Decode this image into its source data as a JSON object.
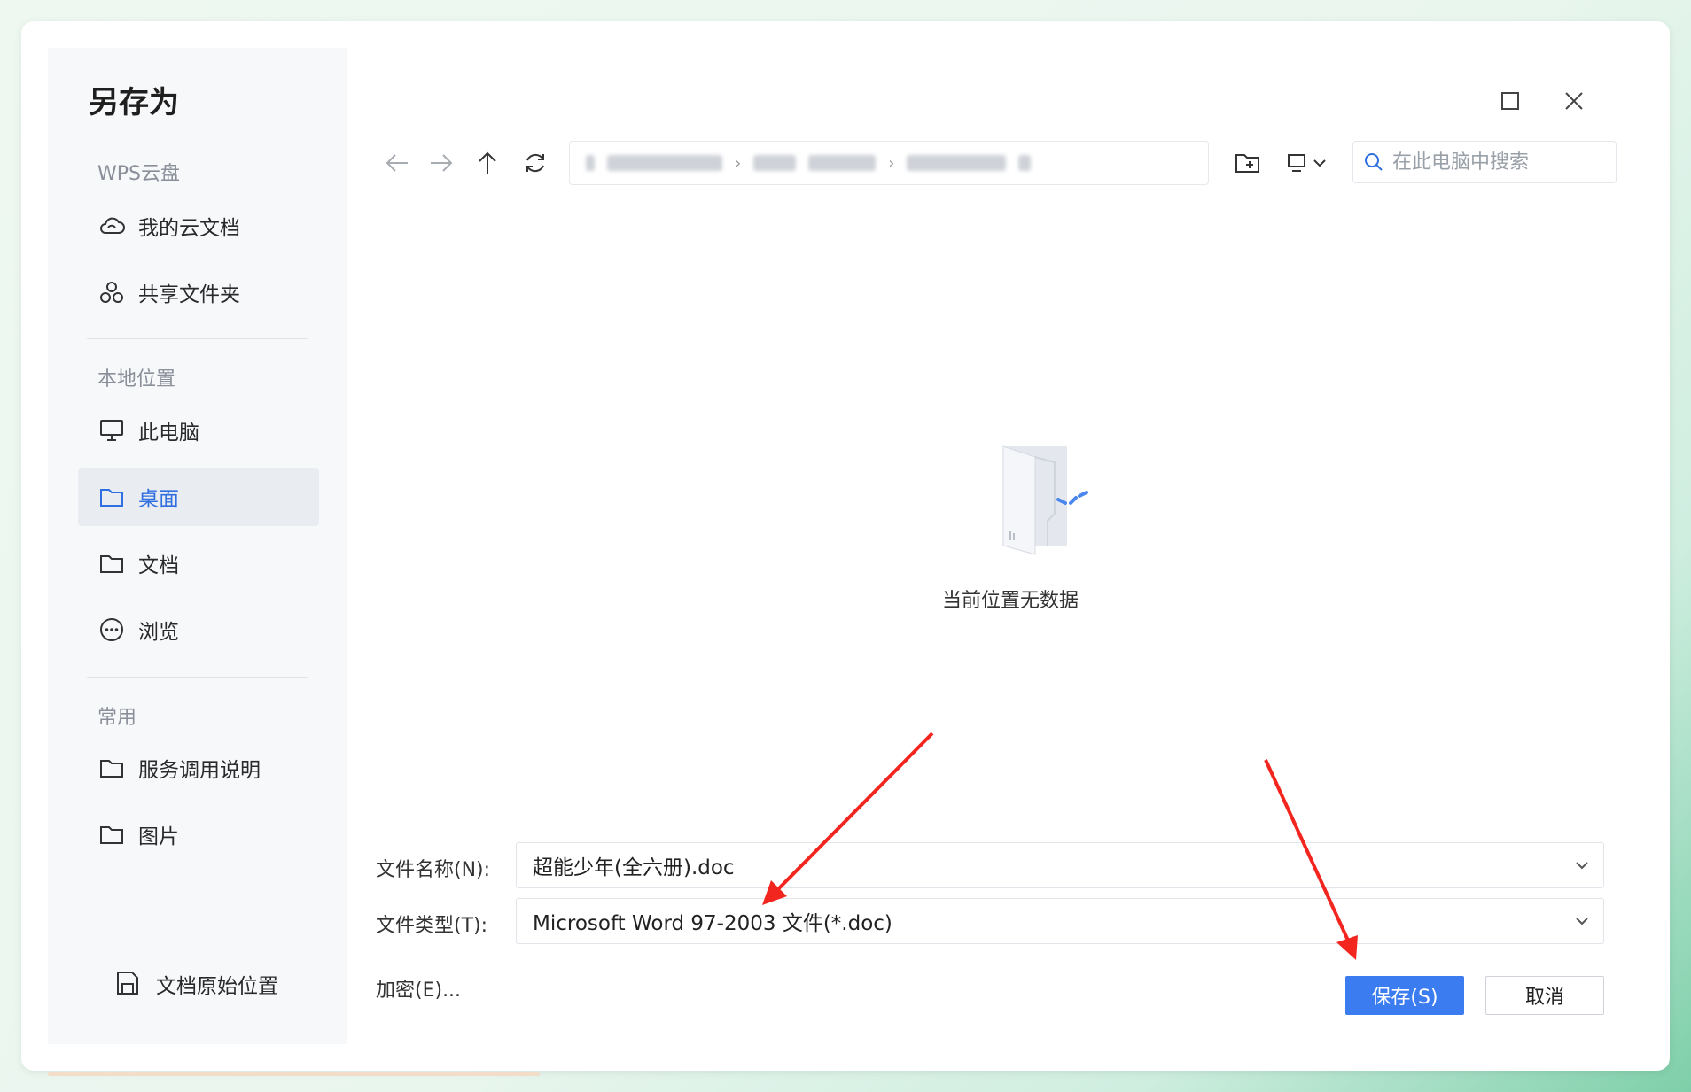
{
  "dialog": {
    "title": "另存为"
  },
  "sidebar": {
    "sections": [
      {
        "label": "WPS云盘",
        "items": [
          {
            "label": "我的云文档",
            "icon": "cloud-icon"
          },
          {
            "label": "共享文件夹",
            "icon": "share-icon"
          }
        ]
      },
      {
        "label": "本地位置",
        "items": [
          {
            "label": "此电脑",
            "icon": "computer-icon"
          },
          {
            "label": "桌面",
            "icon": "folder-icon",
            "active": true
          },
          {
            "label": "文档",
            "icon": "folder-icon"
          },
          {
            "label": "浏览",
            "icon": "more-icon"
          }
        ]
      },
      {
        "label": "常用",
        "items": [
          {
            "label": "服务调用说明",
            "icon": "folder-icon"
          },
          {
            "label": "图片",
            "icon": "folder-icon"
          }
        ]
      }
    ],
    "bottom_link": "文档原始位置"
  },
  "toolbar": {
    "search_placeholder": "在此电脑中搜索"
  },
  "main": {
    "empty_message": "当前位置无数据"
  },
  "form": {
    "filename_label": "文件名称(N):",
    "filename_value": "超能少年(全六册).doc",
    "filetype_label": "文件类型(T):",
    "filetype_value": "Microsoft Word 97-2003 文件(*.doc)",
    "encrypt_label": "加密(E)..."
  },
  "buttons": {
    "save": "保存(S)",
    "cancel": "取消"
  },
  "colors": {
    "primary": "#3b7cf0",
    "active_text": "#2f6fe0",
    "annotation_arrow": "#f2261f"
  }
}
